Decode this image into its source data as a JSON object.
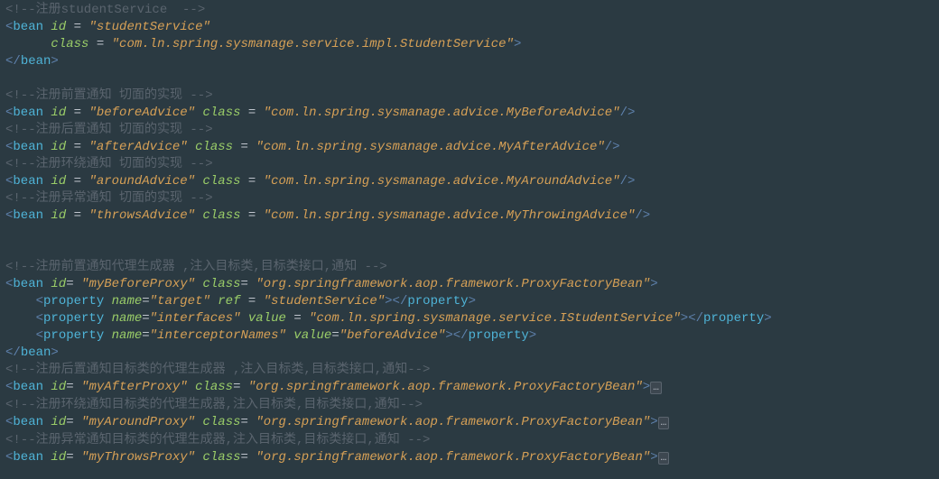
{
  "code": {
    "c1": "<!--注册studentService  -->",
    "l2_tag": "bean",
    "l2_id_name": "id",
    "l2_id_val": "\"studentService\"",
    "l3_cls_name": "class",
    "l3_cls_val": "\"com.ln.spring.sysmanage.service.impl.StudentService\"",
    "l4_close": "bean",
    "c6": "<!--注册前置通知 切面的实现 -->",
    "l7_tag": "bean",
    "l7_id_name": "id",
    "l7_id_val": "\"beforeAdvice\"",
    "l7_cls_name": "class",
    "l7_cls_val": "\"com.ln.spring.sysmanage.advice.MyBeforeAdvice\"",
    "c8": "<!--注册后置通知 切面的实现 -->",
    "l9_tag": "bean",
    "l9_id_name": "id",
    "l9_id_val": "\"afterAdvice\"",
    "l9_cls_name": "class",
    "l9_cls_val": "\"com.ln.spring.sysmanage.advice.MyAfterAdvice\"",
    "c10": "<!--注册环绕通知 切面的实现 -->",
    "l11_tag": "bean",
    "l11_id_name": "id",
    "l11_id_val": "\"aroundAdvice\"",
    "l11_cls_name": "class",
    "l11_cls_val": "\"com.ln.spring.sysmanage.advice.MyAroundAdvice\"",
    "c12": "<!--注册异常通知 切面的实现 -->",
    "l13_tag": "bean",
    "l13_id_name": "id",
    "l13_id_val": "\"throwsAdvice\"",
    "l13_cls_name": "class",
    "l13_cls_val": "\"com.ln.spring.sysmanage.advice.MyThrowingAdvice\"",
    "c16": "<!--注册前置通知代理生成器 ,注入目标类,目标类接口,通知 -->",
    "l17_tag": "bean",
    "l17_id_name": "id",
    "l17_id_val": "\"myBeforeProxy\"",
    "l17_cls_name": "class",
    "l17_cls_val": "\"org.springframework.aop.framework.ProxyFactoryBean\"",
    "l18_tag": "property",
    "l18_n_name": "name",
    "l18_n_val": "\"target\"",
    "l18_r_name": "ref",
    "l18_r_val": "\"studentService\"",
    "l19_tag": "property",
    "l19_n_name": "name",
    "l19_n_val": "\"interfaces\"",
    "l19_v_name": "value",
    "l19_v_val": "\"com.ln.spring.sysmanage.service.IStudentService\"",
    "l20_tag": "property",
    "l20_n_name": "name",
    "l20_n_val": "\"interceptorNames\"",
    "l20_v_name": "value",
    "l20_v_val": "\"beforeAdvice\"",
    "l21_close": "bean",
    "c22": "<!--注册后置通知目标类的代理生成器 ,注入目标类,目标类接口,通知-->",
    "l23_tag": "bean",
    "l23_id_name": "id",
    "l23_id_val": "\"myAfterProxy\"",
    "l23_cls_name": "class",
    "l23_cls_val": "\"org.springframework.aop.framework.ProxyFactoryBean\"",
    "c24": "<!--注册环绕通知目标类的代理生成器,注入目标类,目标类接口,通知-->",
    "l25_tag": "bean",
    "l25_id_name": "id",
    "l25_id_val": "\"myAroundProxy\"",
    "l25_cls_name": "class",
    "l25_cls_val": "\"org.springframework.aop.framework.ProxyFactoryBean\"",
    "c26": "<!--注册异常通知目标类的代理生成器,注入目标类,目标类接口,通知 -->",
    "l27_tag": "bean",
    "l27_id_name": "id",
    "l27_id_val": "\"myThrowsProxy\"",
    "l27_cls_name": "class",
    "l27_cls_val": "\"org.springframework.aop.framework.ProxyFactoryBean\"",
    "fold": "…"
  }
}
